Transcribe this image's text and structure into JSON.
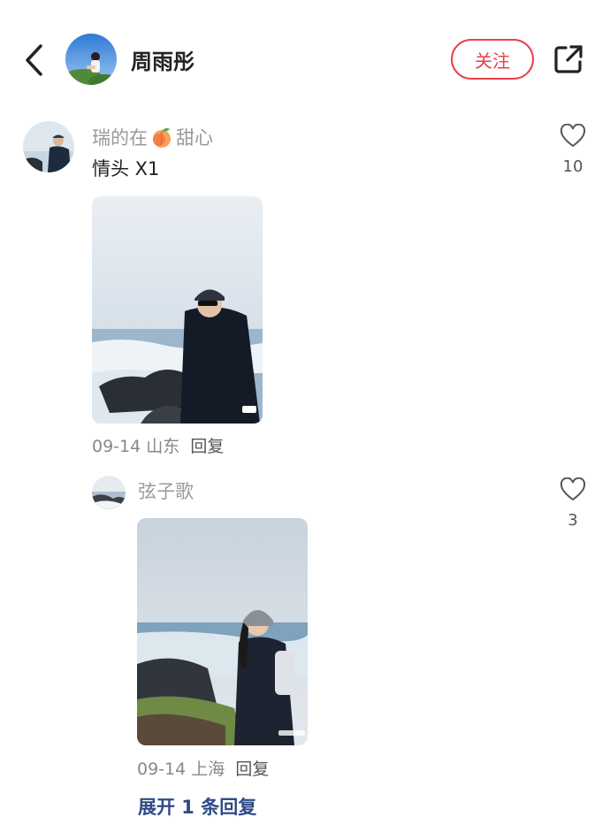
{
  "header": {
    "author_name": "周雨彤",
    "follow_label": "关注",
    "back_icon": "back-chevron-icon",
    "share_icon": "share-icon"
  },
  "comment": {
    "username_prefix": "瑞的在",
    "username_suffix": "甜心",
    "username_emoji": "peach-emoji",
    "text": "情头 X1",
    "like_count": "10",
    "date": "09-14",
    "location": "山东",
    "reply_label": "回复"
  },
  "reply": {
    "username": "弦子歌",
    "like_count": "3",
    "date": "09-14",
    "location": "上海",
    "reply_label": "回复"
  },
  "expand_label": "展开 1 条回复",
  "colors": {
    "accent": "#e8404a",
    "link": "#2f4a86",
    "muted": "#9a9a9a"
  }
}
